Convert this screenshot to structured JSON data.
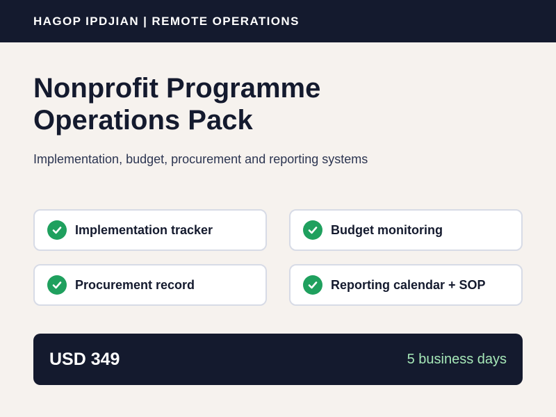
{
  "header": {
    "title": "HAGOP IPDJIAN | REMOTE OPERATIONS"
  },
  "main": {
    "title_line1": "Nonprofit Programme",
    "title_line2": "Operations Pack",
    "subtitle": "Implementation, budget, procurement and reporting systems"
  },
  "features": [
    {
      "label": "Implementation tracker",
      "icon": "check-circle-icon"
    },
    {
      "label": "Budget monitoring",
      "icon": "check-circle-icon"
    },
    {
      "label": "Procurement record",
      "icon": "check-circle-icon"
    },
    {
      "label": "Reporting calendar + SOP",
      "icon": "check-circle-icon"
    }
  ],
  "pricing": {
    "price": "USD 349",
    "delivery": "5 business days"
  },
  "colors": {
    "navy": "#141a2e",
    "background": "#f6f2ee",
    "check_green": "#1fa05e",
    "delivery_green": "#a6e8b8"
  }
}
